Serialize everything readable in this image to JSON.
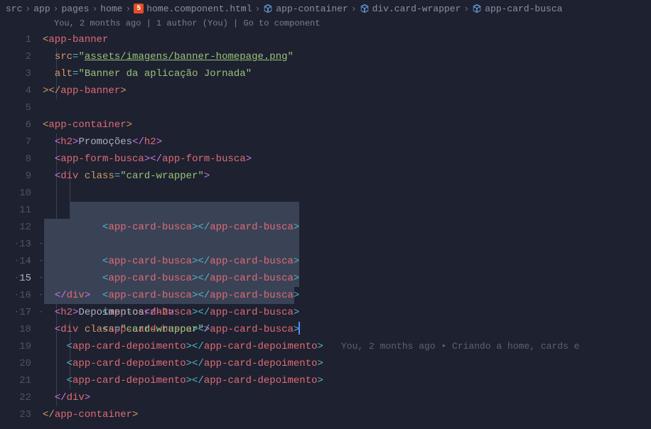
{
  "breadcrumb": {
    "items": [
      {
        "label": "src",
        "icon": null
      },
      {
        "label": "app",
        "icon": null
      },
      {
        "label": "pages",
        "icon": null
      },
      {
        "label": "home",
        "icon": null
      },
      {
        "label": "home.component.html",
        "icon": "html"
      },
      {
        "label": "app-container",
        "icon": "cube"
      },
      {
        "label": "div.card-wrapper",
        "icon": "cube"
      },
      {
        "label": "app-card-busca",
        "icon": "cube"
      }
    ],
    "sep": "›"
  },
  "codelens": "You, 2 months ago | 1 author (You) | Go to component",
  "blame": {
    "line15": "You, 2 months ago • Criando a home, cards e"
  },
  "gutter": [
    "1",
    "2",
    "3",
    "4",
    "5",
    "6",
    "7",
    "8",
    "9",
    "10",
    "11",
    "12",
    "13",
    "14",
    "15",
    "16",
    "17",
    "18",
    "19",
    "20",
    "21",
    "22",
    "23"
  ],
  "code": {
    "l1": {
      "tag": "app-banner"
    },
    "l2": {
      "attr": "src",
      "val": "assets/imagens/banner-homepage.png"
    },
    "l3": {
      "attr": "alt",
      "val": "Banner da aplicação Jornada"
    },
    "l4": {
      "tag": "app-banner"
    },
    "l6": {
      "tag": "app-container"
    },
    "l7": {
      "tag": "h2",
      "text": "Promoções"
    },
    "l8": {
      "tag": "app-form-busca"
    },
    "l9": {
      "tag": "div",
      "attr": "class",
      "val": "card-wrapper"
    },
    "l10": {
      "tag": "app-card-busca"
    },
    "l11": {
      "tag": "app-card-busca"
    },
    "l12": {
      "tag": "app-card-busca"
    },
    "l13": {
      "tag": "app-card-busca"
    },
    "l14": {
      "tag": "app-card-busca"
    },
    "l15": {
      "tag": "app-card-busca"
    },
    "l16": {
      "tag": "div"
    },
    "l17": {
      "tag": "h2",
      "text": "Depoimentos"
    },
    "l18": {
      "tag": "div",
      "attr": "class",
      "val": "card-wrapper"
    },
    "l19": {
      "tag": "app-card-depoimento"
    },
    "l20": {
      "tag": "app-card-depoimento"
    },
    "l21": {
      "tag": "app-card-depoimento"
    },
    "l22": {
      "tag": "div"
    },
    "l23": {
      "tag": "app-container"
    }
  }
}
